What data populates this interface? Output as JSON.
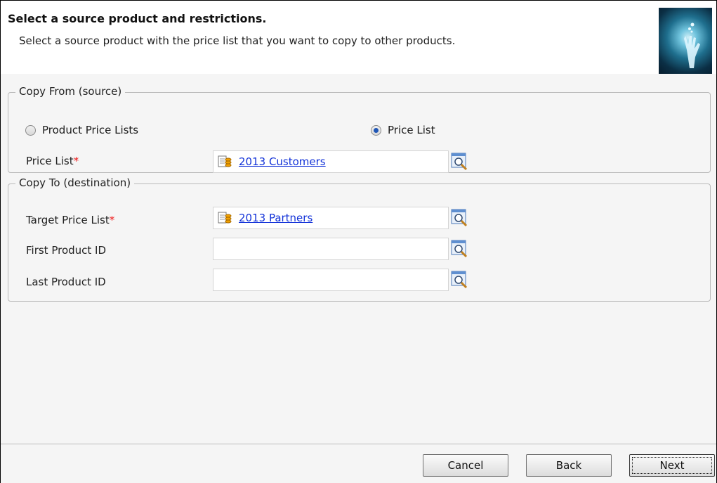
{
  "header": {
    "title": "Select a source product and restrictions.",
    "subtitle": "Select a source product with the price list that you want to copy to other products."
  },
  "copy_from": {
    "legend": "Copy From (source)",
    "radio_product_price_lists": {
      "label": "Product Price Lists",
      "checked": false
    },
    "radio_price_list": {
      "label": "Price List",
      "checked": true
    },
    "price_list": {
      "label": "Price List",
      "required_marker": "*",
      "value": "2013 Customers"
    }
  },
  "copy_to": {
    "legend": "Copy To (destination)",
    "target_price_list": {
      "label": "Target Price List",
      "required_marker": "*",
      "value": "2013 Partners"
    },
    "first_product_id": {
      "label": "First Product ID",
      "value": ""
    },
    "last_product_id": {
      "label": "Last Product ID",
      "value": ""
    }
  },
  "footer": {
    "cancel_label": "Cancel",
    "back_label": "Back",
    "next_label": "Next"
  },
  "icons": {
    "header_image": "wizard-hand-graphic",
    "record": "price-list-record-icon",
    "lookup": "lookup-magnifier-icon"
  },
  "colors": {
    "link": "#1232d8",
    "required": "#e11111",
    "radio_selected": "#1f56b5"
  }
}
